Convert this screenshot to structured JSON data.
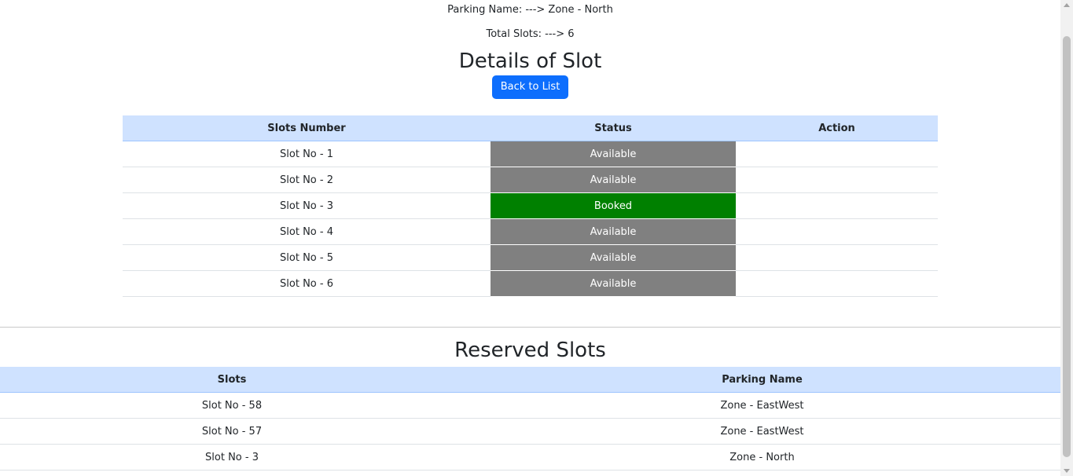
{
  "header": {
    "parking_name_line": "Parking Name: ---> Zone - North",
    "total_slots_line": "Total Slots: ---> 6"
  },
  "details": {
    "title": "Details of Slot",
    "back_button_label": "Back to List",
    "columns": [
      "Slots Number",
      "Status",
      "Action"
    ],
    "rows": [
      {
        "slot": "Slot No - 1",
        "status": "Available",
        "action": ""
      },
      {
        "slot": "Slot No - 2",
        "status": "Available",
        "action": ""
      },
      {
        "slot": "Slot No - 3",
        "status": "Booked",
        "action": ""
      },
      {
        "slot": "Slot No - 4",
        "status": "Available",
        "action": ""
      },
      {
        "slot": "Slot No - 5",
        "status": "Available",
        "action": ""
      },
      {
        "slot": "Slot No - 6",
        "status": "Available",
        "action": ""
      }
    ]
  },
  "reserved": {
    "title": "Reserved Slots",
    "columns": [
      "Slots",
      "Parking Name"
    ],
    "rows": [
      {
        "slot": "Slot No - 58",
        "parking_name": "Zone - EastWest"
      },
      {
        "slot": "Slot No - 57",
        "parking_name": "Zone - EastWest"
      },
      {
        "slot": "Slot No - 3",
        "parking_name": "Zone - North"
      }
    ]
  },
  "colors": {
    "available": "#808080",
    "booked": "#008000",
    "header_bg": "#cfe2ff",
    "button_bg": "#0d6efd"
  }
}
